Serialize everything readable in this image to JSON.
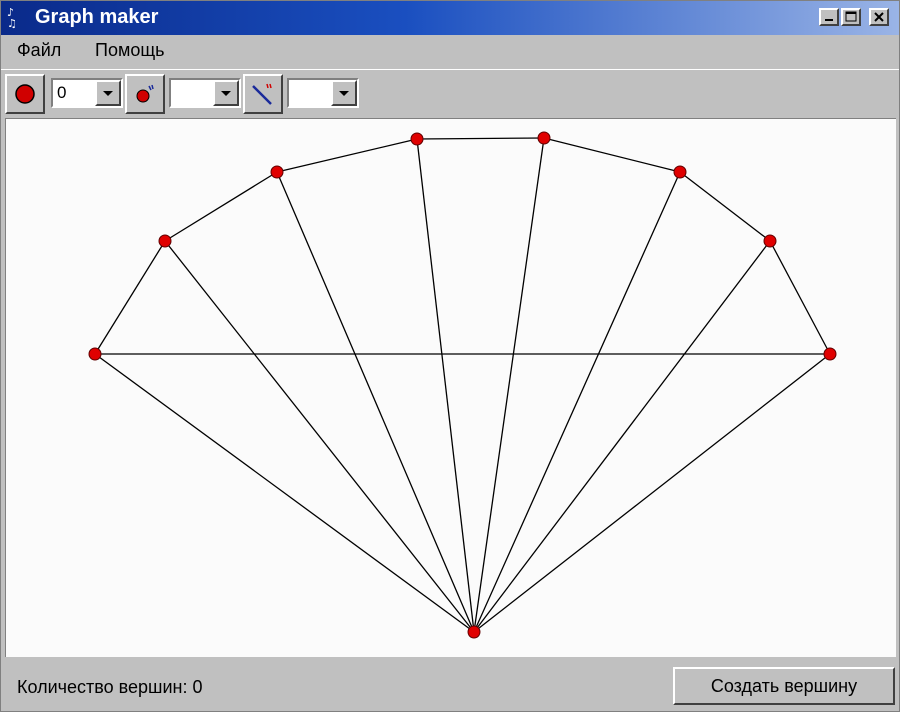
{
  "window": {
    "title": "Graph maker"
  },
  "menu": {
    "items": [
      "Файл",
      "Помощь"
    ]
  },
  "toolbar": {
    "vertex_tool_icon": "red-dot-icon",
    "combo1_value": "0",
    "vertex_add_icon": "dot-with-sparkle-icon",
    "combo2_value": "",
    "edge_tool_icon": "diagonal-line-icon",
    "combo3_value": ""
  },
  "graph": {
    "vertex_color": "#e00000",
    "edge_color": "#000000",
    "vertices": [
      {
        "id": "v1"
      },
      {
        "id": "v2"
      },
      {
        "id": "v3"
      },
      {
        "id": "v4"
      },
      {
        "id": "v5"
      },
      {
        "id": "v6"
      },
      {
        "id": "v7"
      },
      {
        "id": "v8"
      },
      {
        "id": "center"
      }
    ],
    "edges": [
      [
        "v1",
        "v2"
      ],
      [
        "v2",
        "v3"
      ],
      [
        "v3",
        "v4"
      ],
      [
        "v4",
        "v5"
      ],
      [
        "v5",
        "v6"
      ],
      [
        "v6",
        "v7"
      ],
      [
        "v7",
        "v8"
      ],
      [
        "v1",
        "v8"
      ],
      [
        "v1",
        "center"
      ],
      [
        "v2",
        "center"
      ],
      [
        "v3",
        "center"
      ],
      [
        "v4",
        "center"
      ],
      [
        "v5",
        "center"
      ],
      [
        "v6",
        "center"
      ],
      [
        "v7",
        "center"
      ],
      [
        "v8",
        "center"
      ]
    ]
  },
  "status": {
    "vertex_count_text": "Количество вершин: 0"
  },
  "buttons": {
    "create_vertex": "Создать вершину"
  }
}
